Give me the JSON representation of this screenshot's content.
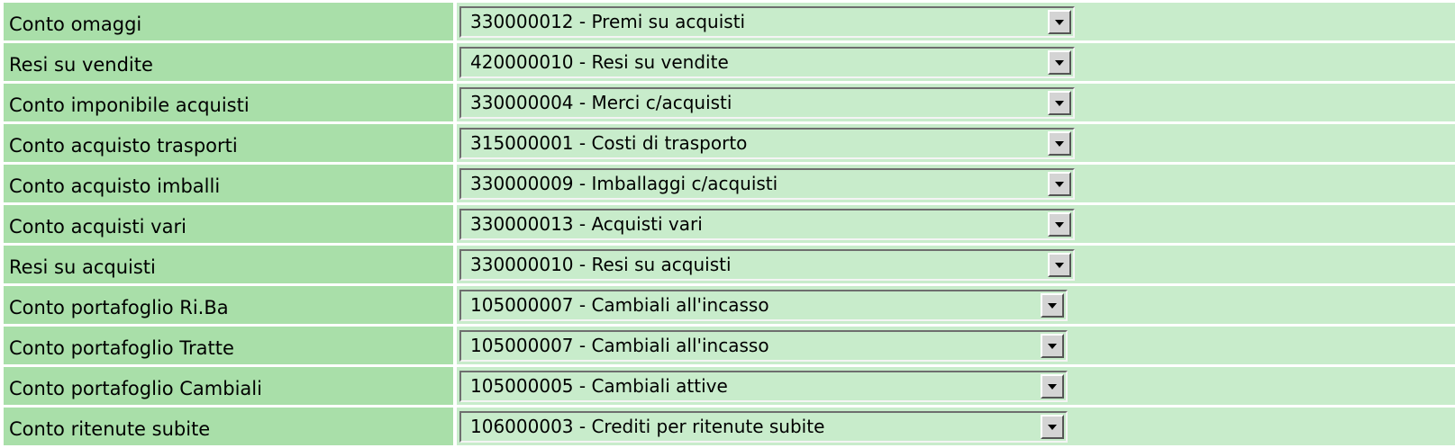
{
  "rows": [
    {
      "label": "Conto omaggi",
      "value": "330000012 - Premi su acquisti"
    },
    {
      "label": "Resi su vendite",
      "value": "420000010 - Resi su vendite"
    },
    {
      "label": "Conto imponibile acquisti",
      "value": "330000004 - Merci c/acquisti"
    },
    {
      "label": "Conto acquisto trasporti",
      "value": "315000001 - Costi di trasporto"
    },
    {
      "label": "Conto acquisto imballi",
      "value": "330000009 - Imballaggi c/acquisti"
    },
    {
      "label": "Conto acquisti vari",
      "value": "330000013 - Acquisti vari"
    },
    {
      "label": "Resi su acquisti",
      "value": "330000010 - Resi su acquisti"
    },
    {
      "label": "Conto portafoglio Ri.Ba",
      "value": "105000007 - Cambiali all'incasso"
    },
    {
      "label": "Conto portafoglio Tratte",
      "value": "105000007 - Cambiali all'incasso"
    },
    {
      "label": "Conto portafoglio Cambiali",
      "value": "105000005 - Cambiali attive"
    },
    {
      "label": "Conto ritenute subite",
      "value": "106000003 - Crediti per ritenute subite"
    }
  ],
  "colors": {
    "label_background": "#a9dfa9",
    "value_background": "#c8eccb"
  },
  "icons": {
    "dropdown": "chevron-down-icon"
  }
}
